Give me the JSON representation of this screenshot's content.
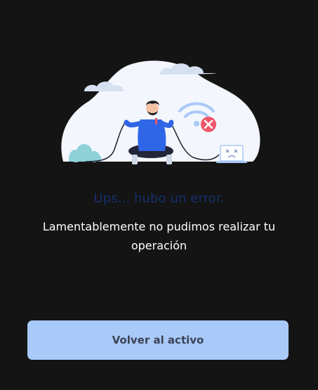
{
  "error": {
    "title": "Ups... hubo un error.",
    "message": "Lamentablemente no pudimos realizar tu operación"
  },
  "actions": {
    "back_label": "Volver al activo"
  },
  "illustration": {
    "name": "disconnected-person-illustration",
    "icons": [
      "wifi-icon",
      "error-x-icon",
      "sad-laptop-icon",
      "cloud-icon",
      "bush-icon"
    ]
  },
  "colors": {
    "background": "#141414",
    "title": "#14306b",
    "message": "#ffffff",
    "button_bg": "#a9c9f8",
    "button_text": "#3b4355",
    "error_badge": "#f0566a",
    "wifi": "#a9c9f8",
    "blob": "#f3f6fd"
  }
}
